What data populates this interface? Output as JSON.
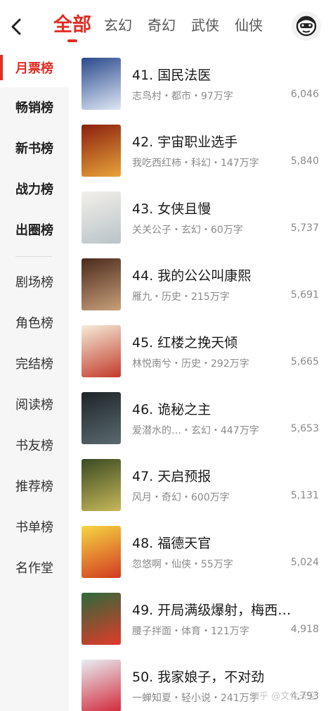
{
  "header": {
    "tabs": [
      "全部",
      "玄幻",
      "奇幻",
      "武侠",
      "仙侠"
    ],
    "active_tab": 0
  },
  "sidebar": {
    "items": [
      {
        "label": "月票榜",
        "active": true
      },
      {
        "label": "畅销榜",
        "bold": true
      },
      {
        "label": "新书榜",
        "bold": true
      },
      {
        "label": "战力榜",
        "bold": true
      },
      {
        "label": "出圈榜",
        "bold": true
      },
      {
        "label": "剧场榜"
      },
      {
        "label": "角色榜"
      },
      {
        "label": "完结榜"
      },
      {
        "label": "阅读榜"
      },
      {
        "label": "书友榜"
      },
      {
        "label": "推荐榜"
      },
      {
        "label": "书单榜"
      },
      {
        "label": "名作堂"
      }
    ]
  },
  "books": [
    {
      "title": "41. 国民法医",
      "meta": "志鸟村・都市・97万字",
      "count": "6,046",
      "cover_colors": [
        "#2a4a8c",
        "#dfe7f5"
      ]
    },
    {
      "title": "42. 宇宙职业选手",
      "meta": "我吃西红柿・科幻・147万字",
      "count": "5,840",
      "cover_colors": [
        "#8a1f0f",
        "#e8a43a"
      ]
    },
    {
      "title": "43. 女侠且慢",
      "meta": "关关公子・玄幻・60万字",
      "count": "5,737",
      "cover_colors": [
        "#f3f0ea",
        "#b9c3c8"
      ]
    },
    {
      "title": "44. 我的公公叫康熙",
      "meta": "雁九・历史・215万字",
      "count": "5,691",
      "cover_colors": [
        "#4a2a1c",
        "#c9a07a"
      ]
    },
    {
      "title": "45. 红楼之挽天倾",
      "meta": "林悦南兮・历史・292万字",
      "count": "5,665",
      "cover_colors": [
        "#f5ecd8",
        "#c23a2a"
      ]
    },
    {
      "title": "46. 诡秘之主",
      "meta": "爱潜水的…・玄幻・447万字",
      "count": "5,653",
      "cover_colors": [
        "#1e2428",
        "#5a6a70"
      ]
    },
    {
      "title": "47. 天启预报",
      "meta": "风月・奇幻・600万字",
      "count": "5,131",
      "cover_colors": [
        "#3a4a22",
        "#c7b85a"
      ]
    },
    {
      "title": "48. 福德天官",
      "meta": "忽悠啊・仙侠・55万字",
      "count": "5,024",
      "cover_colors": [
        "#f6d640",
        "#d23a22"
      ]
    },
    {
      "title": "49. 开局满级爆射，梅西…",
      "meta": "腰子拌面・体育・121万字",
      "count": "4,918",
      "cover_colors": [
        "#2c6a3a",
        "#e23a2a"
      ]
    },
    {
      "title": "50. 我家娘子，不对劲",
      "meta": "一蝉知夏・轻小说・241万字",
      "count": "4,793",
      "cover_colors": [
        "#e8eef4",
        "#d22a3a"
      ]
    }
  ],
  "watermark": "知乎 @文化天空",
  "colors": {
    "accent": "#e02e24",
    "sidebar_bg": "#f6f6f6",
    "meta_text": "#8a8a8a"
  }
}
